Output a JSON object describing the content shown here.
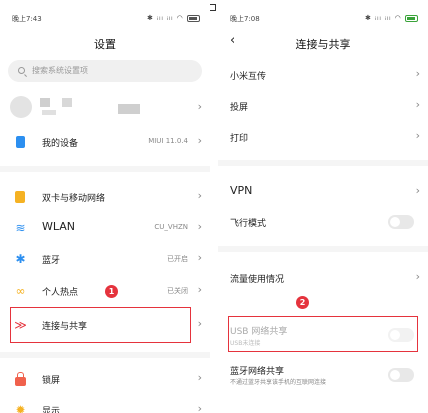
{
  "left": {
    "status_time": "晚上7:43",
    "status_right": "✱ ᵢₗₗ ᵢₗₗ ◠",
    "title": "设置",
    "search_placeholder": "搜索系统设置项",
    "device": {
      "label": "我的设备",
      "value": "MIUI 11.0.4"
    },
    "rows": [
      {
        "label": "双卡与移动网络",
        "value": ""
      },
      {
        "label": "WLAN",
        "value": "CU_VHZN"
      },
      {
        "label": "蓝牙",
        "value": "已开启"
      },
      {
        "label": "个人热点",
        "value": "已关闭"
      },
      {
        "label": "连接与共享",
        "value": ""
      }
    ],
    "bottom_rows": [
      {
        "label": "锁屏"
      },
      {
        "label": "显示"
      }
    ],
    "badge": "1"
  },
  "right": {
    "status_time": "晚上7:08",
    "status_right": "✱ ᵢₗₗ ᵢₗₗ ◠",
    "title": "连接与共享",
    "rows1": [
      {
        "label": "小米互传"
      },
      {
        "label": "投屏"
      },
      {
        "label": "打印"
      }
    ],
    "vpn": "VPN",
    "airplane": "飞行模式",
    "data_usage": "流量使用情况",
    "usb_title": "USB 网络共享",
    "usb_sub": "USB未连接",
    "bt_title": "蓝牙网络共享",
    "bt_sub": "不通过蓝牙共享该手机的互联网连接",
    "badge": "2"
  },
  "icons": {
    "chevron": "›",
    "back": "‹",
    "wifi": "≋",
    "bluetooth": "✱",
    "hotspot": "∞",
    "share": "≫",
    "display": "✹"
  },
  "colors": {
    "accent_red": "#e5333d",
    "blue": "#2c8ff0",
    "sim_yellow": "#f5b223",
    "lock_red": "#f0614c"
  }
}
